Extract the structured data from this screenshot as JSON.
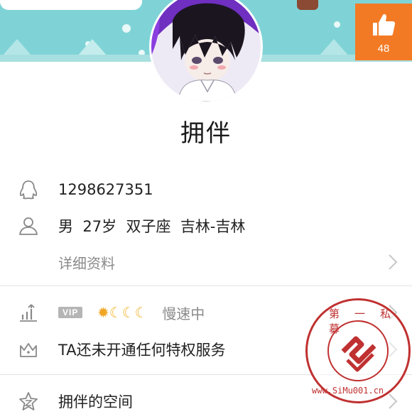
{
  "like": {
    "count": "48"
  },
  "profile": {
    "name": "拥伴",
    "qq": "1298627351",
    "info": {
      "gender": "男",
      "age": "27岁",
      "sign": "双子座",
      "location": "吉林-吉林"
    },
    "detail_link": "详细资料"
  },
  "vip": {
    "badge": "VIP",
    "level_icons": [
      "sun",
      "moon",
      "moon",
      "moon"
    ],
    "status": "慢速中"
  },
  "privilege": {
    "text": "TA还未开通任何特权服务"
  },
  "space": {
    "text": "拥伴的空间"
  },
  "watermark": {
    "top_text": "第 一 私 募",
    "bottom_text": "www.SiMu001.cn"
  },
  "colors": {
    "header_bg": "#7fd3d6",
    "like_bg": "#f37a24",
    "watermark": "#c03131",
    "muted_text": "#8a8a8a"
  }
}
